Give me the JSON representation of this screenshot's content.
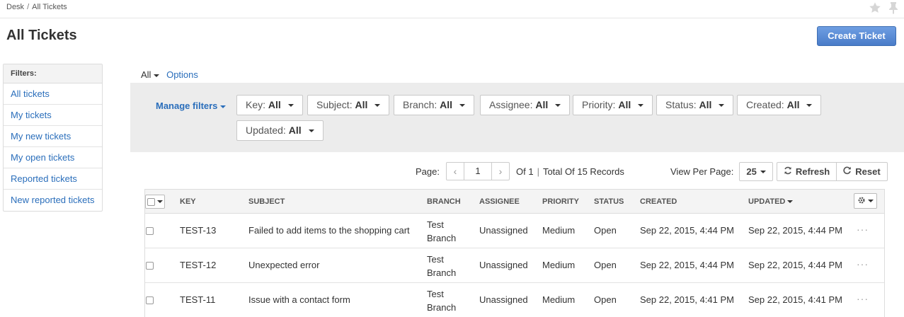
{
  "breadcrumb": {
    "items": [
      "Desk",
      "All Tickets"
    ],
    "separator": "/"
  },
  "header": {
    "title": "All Tickets",
    "create_button": "Create Ticket"
  },
  "filters": {
    "heading": "Filters:",
    "items": [
      "All tickets",
      "My tickets",
      "My new tickets",
      "My open tickets",
      "Reported tickets",
      "New reported tickets"
    ]
  },
  "view": {
    "selector": "All",
    "options": "Options"
  },
  "filter_bar": {
    "manage": "Manage filters",
    "chips": [
      {
        "label": "Key:",
        "value": "All"
      },
      {
        "label": "Subject:",
        "value": "All"
      },
      {
        "label": "Branch:",
        "value": "All"
      },
      {
        "label": "Assignee:",
        "value": "All"
      },
      {
        "label": "Priority:",
        "value": "All"
      },
      {
        "label": "Status:",
        "value": "All"
      },
      {
        "label": "Created:",
        "value": "All"
      },
      {
        "label": "Updated:",
        "value": "All"
      }
    ]
  },
  "pager": {
    "label": "Page:",
    "page": "1",
    "of": "Of 1",
    "separator": "|",
    "total": "Total Of 15 Records",
    "prev": "‹",
    "next": "›"
  },
  "view_per_page": {
    "label": "View Per Page:",
    "value": "25",
    "refresh": "Refresh",
    "reset": "Reset"
  },
  "table": {
    "columns": [
      "KEY",
      "SUBJECT",
      "BRANCH",
      "ASSIGNEE",
      "PRIORITY",
      "STATUS",
      "CREATED",
      "UPDATED"
    ],
    "rows": [
      {
        "key": "TEST-13",
        "subject": "Failed to add items to the shopping cart",
        "branch": "Test Branch",
        "assignee": "Unassigned",
        "priority": "Medium",
        "status": "Open",
        "created": "Sep 22, 2015, 4:44 PM",
        "updated": "Sep 22, 2015, 4:44 PM",
        "more": "···"
      },
      {
        "key": "TEST-12",
        "subject": "Unexpected error",
        "branch": "Test Branch",
        "assignee": "Unassigned",
        "priority": "Medium",
        "status": "Open",
        "created": "Sep 22, 2015, 4:44 PM",
        "updated": "Sep 22, 2015, 4:44 PM",
        "more": "···"
      },
      {
        "key": "TEST-11",
        "subject": "Issue with a contact form",
        "branch": "Test Branch",
        "assignee": "Unassigned",
        "priority": "Medium",
        "status": "Open",
        "created": "Sep 22, 2015, 4:41 PM",
        "updated": "Sep 22, 2015, 4:41 PM",
        "more": "···"
      }
    ]
  },
  "colors": {
    "link": "#2a6ebb",
    "primary_button": "#4a7cc9",
    "filter_bar_bg": "#ececec"
  }
}
